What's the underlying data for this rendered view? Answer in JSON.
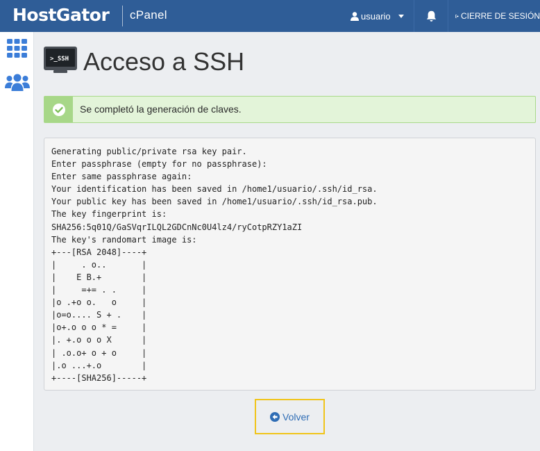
{
  "header": {
    "brand": "HostGator",
    "product": "cPanel",
    "username": "usuario",
    "logout_label": "CIERRE DE SESIÓN",
    "icons": [
      "user-icon",
      "caret-down-icon",
      "bell-icon",
      "logout-icon"
    ],
    "bg_color": "#2f5d97"
  },
  "sidebar": {
    "items": [
      {
        "name": "home",
        "icon": "grid-icon"
      },
      {
        "name": "users",
        "icon": "users-icon"
      }
    ]
  },
  "page": {
    "icon": "ssh-terminal-icon",
    "icon_text": ">_SSH",
    "title": "Acceso a SSH"
  },
  "alert": {
    "type": "success",
    "icon": "check-circle-icon",
    "message": "Se completó la generación de claves."
  },
  "console": {
    "lines": [
      "Generating public/private rsa key pair.",
      "Enter passphrase (empty for no passphrase):",
      "Enter same passphrase again:",
      "Your identification has been saved in /home1/usuario/.ssh/id_rsa.",
      "Your public key has been saved in /home1/usuario/.ssh/id_rsa.pub.",
      "The key fingerprint is:",
      "SHA256:5q01Q/GaSVqrILQL2GDCnNc0U4lz4/ryCotpRZY1aZI",
      "The key's randomart image is:",
      "+---[RSA 2048]----+",
      "|     . o..       |",
      "|    E B.+        |",
      "|     =+= . .     |",
      "|o .+o o.   o     |",
      "|o=o.... S + .    |",
      "|o+.o o o * =     |",
      "|. +.o o o X      |",
      "| .o.o+ o + o     |",
      "|.o ...+.o        |",
      "+----[SHA256]-----+"
    ]
  },
  "actions": {
    "back_label": "Volver",
    "back_icon": "arrow-circle-left-icon"
  }
}
